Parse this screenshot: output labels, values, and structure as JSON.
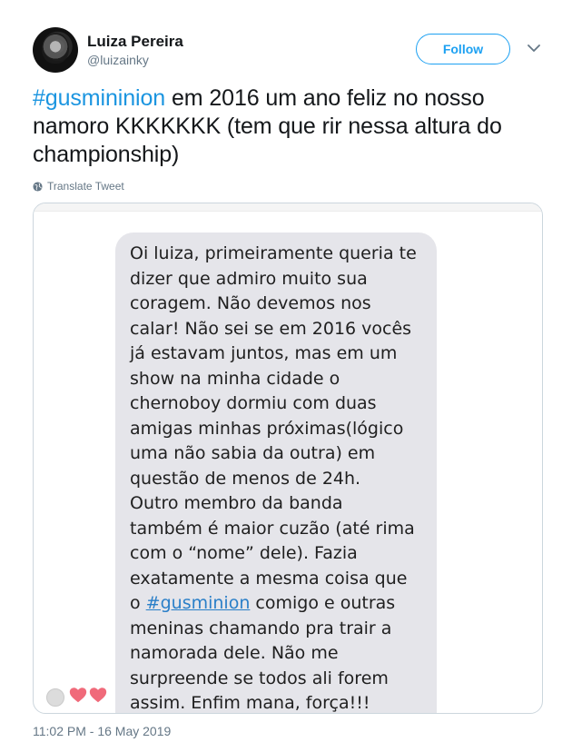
{
  "author": {
    "name": "Luiza Pereira",
    "handle": "@luizainky"
  },
  "actions": {
    "follow_label": "Follow"
  },
  "tweet": {
    "hashtag": "#gusmininion",
    "text_rest": " em 2016 um ano feliz no nosso namoro KKKKKKK (tem que rir nessa altura do championship)"
  },
  "translate_label": "Translate Tweet",
  "message": {
    "lines": [
      "Oi luiza, primeiramente queria te",
      "dizer que admiro muito sua",
      "coragem. Não devemos nos",
      "calar! Não sei se em 2016 vocês",
      "já estavam juntos, mas em um",
      "show na minha cidade o",
      "chernoboy dormiu com duas",
      "amigas minhas próximas(lógico",
      "uma não sabia da outra) em",
      "questão de menos de 24h.",
      "Outro membro da banda",
      "também é maior cuzão (até rima",
      "com o “nome” dele). Fazia",
      "exatamente a mesma coisa que"
    ],
    "line15_prefix": "o ",
    "line15_link": "#gusminion",
    "line15_suffix": " comigo e outras",
    "lines_after": [
      "meninas chamando pra trair a",
      "namorada dele. Não me",
      "surpreende se todos ali forem",
      "assim. Enfim mana, força!!!"
    ]
  },
  "timestamp": "11:02 PM - 16 May 2019",
  "colors": {
    "accent": "#1da1f2",
    "hashtag": "#1b95e0",
    "bubble": "#e5e5ea",
    "heart": "#f06a7a"
  },
  "icons": [
    "globe-icon",
    "chevron-down-icon",
    "heart-icon",
    "reaction-icon"
  ]
}
